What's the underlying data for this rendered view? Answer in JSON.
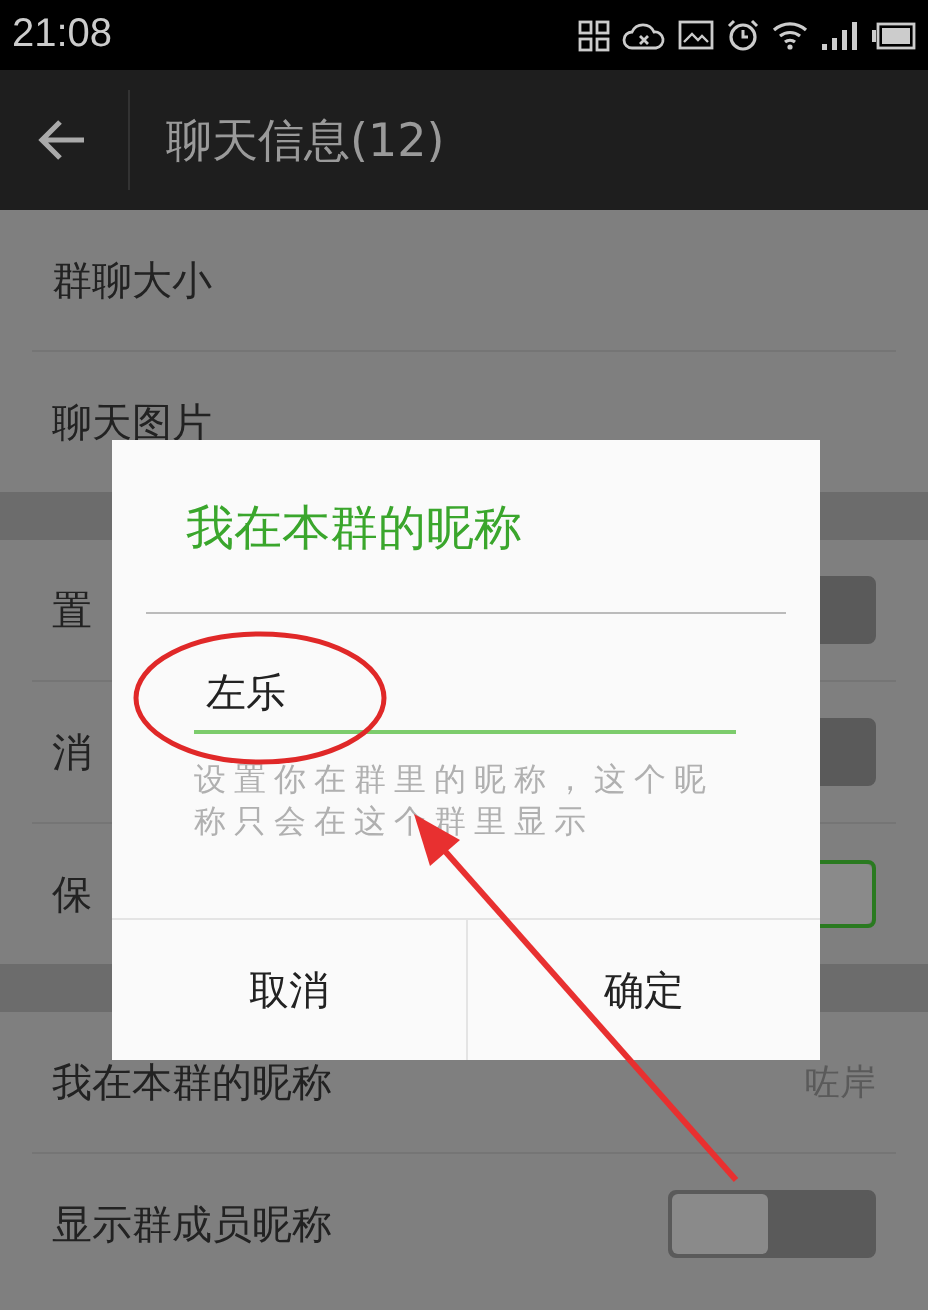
{
  "status_bar": {
    "time": "21:08"
  },
  "toolbar": {
    "title": "聊天信息(12)"
  },
  "groups": [
    {
      "rows": [
        {
          "kind": "plain",
          "label": "群聊大小"
        },
        {
          "kind": "plain",
          "label": "聊天图片"
        }
      ]
    },
    {
      "rows": [
        {
          "kind": "toggle",
          "label": "置",
          "on": false
        },
        {
          "kind": "toggle",
          "label": "消",
          "on": false
        },
        {
          "kind": "toggle",
          "label": "保",
          "on": true
        }
      ]
    },
    {
      "rows": [
        {
          "kind": "value",
          "label": "我在本群的昵称",
          "value": "咗岸"
        },
        {
          "kind": "toggle",
          "label": "显示群成员昵称",
          "on": false
        }
      ]
    }
  ],
  "dialog": {
    "title": "我在本群的昵称",
    "value": "左乐",
    "hint": "设置你在群里的昵称，这个昵称只会在这个群里显示",
    "buttons": [
      "取消",
      "确定"
    ]
  }
}
